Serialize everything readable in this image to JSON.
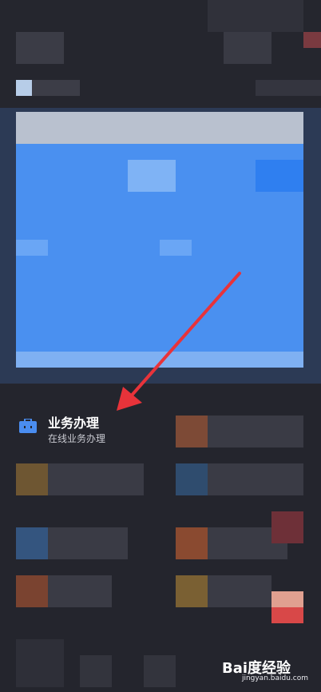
{
  "service_featured": {
    "title": "业务办理",
    "subtitle": "在线业务办理",
    "icon": "briefcase-icon"
  },
  "watermark": {
    "brand": "Bai度经验",
    "url": "jingyan.baidu.com"
  },
  "colors": {
    "background": "#24252d",
    "banner_blue": "#4a90f0",
    "icon_blue": "#4a8df0",
    "arrow_red": "#e8333a"
  }
}
